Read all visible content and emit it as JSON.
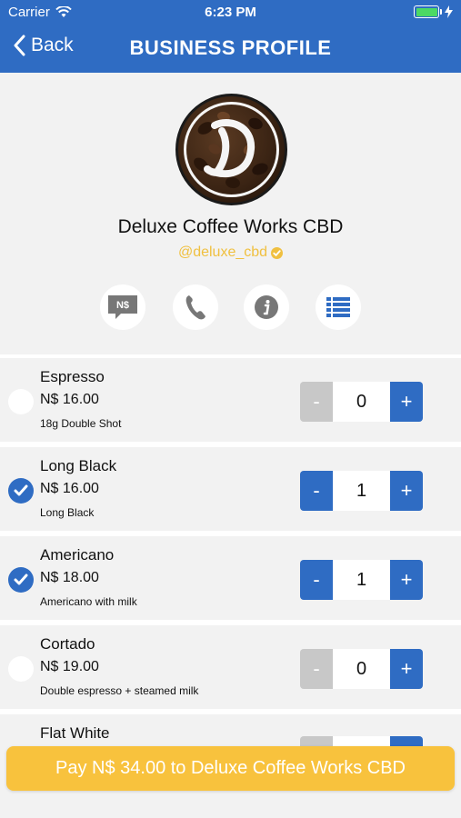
{
  "status_bar": {
    "carrier": "Carrier",
    "time": "6:23 PM"
  },
  "navbar": {
    "back_label": "Back",
    "title": "BUSINESS PROFILE"
  },
  "business": {
    "name": "Deluxe Coffee Works CBD",
    "handle": "@deluxe_cbd",
    "logo_letter": "D",
    "action_message_label": "N$"
  },
  "menu": [
    {
      "name": "Espresso",
      "price": "N$ 16.00",
      "description": "18g Double Shot",
      "quantity": "0",
      "selected": false
    },
    {
      "name": "Long Black",
      "price": "N$ 16.00",
      "description": "Long Black",
      "quantity": "1",
      "selected": true
    },
    {
      "name": "Americano",
      "price": "N$ 18.00",
      "description": "Americano with milk",
      "quantity": "1",
      "selected": true
    },
    {
      "name": "Cortado",
      "price": "N$ 19.00",
      "description": "Double espresso + steamed milk",
      "quantity": "0",
      "selected": false
    },
    {
      "name": "Flat White",
      "price": "",
      "description": "",
      "quantity": "",
      "selected": false
    }
  ],
  "stepper": {
    "minus_label": "-",
    "plus_label": "+"
  },
  "pay_button": {
    "label": "Pay N$ 34.00 to Deluxe Coffee Works CBD"
  },
  "colors": {
    "header_blue": "#2f6cc3",
    "accent_yellow": "#f8c23d",
    "handle_gold": "#f0c040",
    "background": "#f2f2f2"
  }
}
